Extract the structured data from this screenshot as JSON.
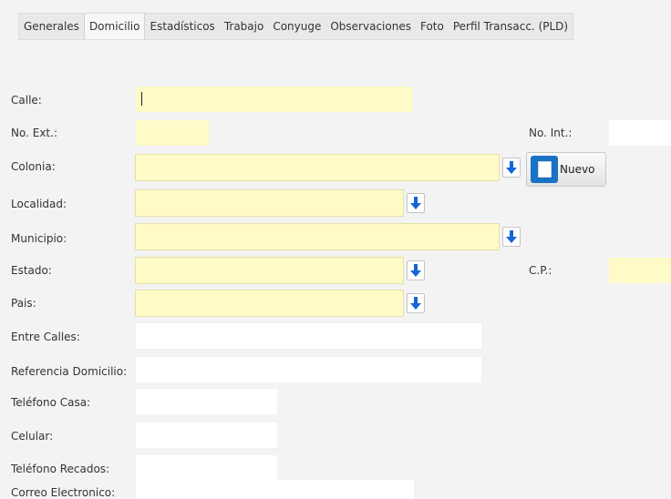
{
  "tabs": [
    {
      "label": "Generales"
    },
    {
      "label": "Domicilio"
    },
    {
      "label": "Estadísticos"
    },
    {
      "label": "Trabajo"
    },
    {
      "label": "Conyuge"
    },
    {
      "label": "Observaciones"
    },
    {
      "label": "Foto"
    },
    {
      "label": "Perfil Transacc. (PLD)"
    }
  ],
  "active_tab": "Domicilio",
  "labels": {
    "calle": "Calle:",
    "no_ext": "No. Ext.:",
    "no_int": "No. Int.:",
    "colonia": "Colonia:",
    "localidad": "Localidad:",
    "municipio": "Municipio:",
    "estado": "Estado:",
    "cp": "C.P.:",
    "pais": "Pais:",
    "entre_calles": "Entre Calles:",
    "referencia": "Referencia Domicilio:",
    "telefono_casa": "Teléfono Casa:",
    "celular": "Celular:",
    "telefono_recados": "Teléfono Recados:",
    "correo": "Correo Electronico:"
  },
  "values": {
    "calle": "",
    "no_ext": "",
    "no_int": "",
    "colonia": "",
    "localidad": "",
    "municipio": "",
    "estado": "",
    "cp": "",
    "pais": "",
    "entre_calles": "",
    "referencia": "",
    "telefono_casa": "",
    "celular": "",
    "telefono_recados": "",
    "correo": ""
  },
  "buttons": {
    "nuevo": "Nuevo"
  },
  "colors": {
    "required_field": "#fefbc8",
    "optional_field": "#ffffff",
    "dropdown_arrow": "#1565d8",
    "nuevo_icon": "#1a72c4"
  },
  "icons": {
    "dropdown": "arrow-down-icon",
    "nuevo": "new-document-icon"
  }
}
